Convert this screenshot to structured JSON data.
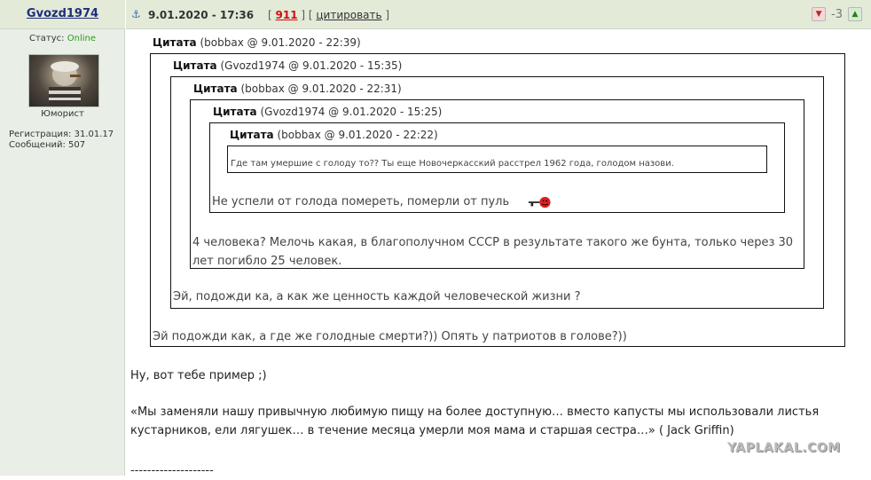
{
  "user": {
    "name": "Gvozd1974",
    "status_label": "Статус:",
    "status_value": "Online",
    "title": "Юморист",
    "registration": "Регистрация: 31.01.17",
    "posts": "Сообщений: 507"
  },
  "post": {
    "anchor_glyph": "⚓",
    "date": "9.01.2020 - 17:36",
    "number_open": "[ ",
    "number": "911",
    "number_close": " ]",
    "quote_open": " [ ",
    "quote_label": "цитировать",
    "quote_close": " ]",
    "rating": "-3"
  },
  "quotes": {
    "q1": {
      "label": "Цитата",
      "meta": "(bobbax @ 9.01.2020 - 22:39)"
    },
    "q2": {
      "label": "Цитата",
      "meta": "(Gvozd1974 @ 9.01.2020 - 15:35)"
    },
    "q3": {
      "label": "Цитата",
      "meta": "(bobbax @ 9.01.2020 - 22:31)"
    },
    "q4": {
      "label": "Цитата",
      "meta": "(Gvozd1974 @ 9.01.2020 - 15:25)"
    },
    "q5": {
      "label": "Цитата",
      "meta": "(bobbax @ 9.01.2020 - 22:22)"
    },
    "q5_text": "Где там умершие с голоду то?? Ты еще Новочеркасский расстрел 1962 года, голодом назови.",
    "q4_text": "Не успели от голода помереть, померли от пуль",
    "q3_text_line1": "4 человека? Мелочь какая, в благополучном СССР в результате такого же бунта, только через 30",
    "q3_text_line2": "лет погибло 25 человек.",
    "q2_text": "Эй, подожди ка, а как же ценность каждой человеческой жизни ?",
    "q1_text": "Эй подожди как, а где же голодные смерти?)) Опять у патриотов в голове?))"
  },
  "body": {
    "line1": "Ну, вот тебе пример ;)",
    "line2": "«Мы заменяли нашу привычную любимую пищу на более доступную… вместо капусты мы использовали листья",
    "line3": "кустарников, ели лягушек… в течение месяца умерли моя мама и старшая сестра…» ( Jack Griffin)",
    "separator": "--------------------"
  },
  "watermark": "YAPLAKAL.COM",
  "icons": {
    "anchor": "anchor-icon",
    "vote_down": "thumb-down-icon",
    "vote_up": "thumb-up-icon",
    "smiley": "shooting-smiley-icon"
  },
  "colors": {
    "sidebar_bg": "#e9efe6",
    "header_bg": "#e3ead8",
    "username": "#1e2f7a",
    "online": "#2a9a1e",
    "post_number": "#cc1111"
  }
}
